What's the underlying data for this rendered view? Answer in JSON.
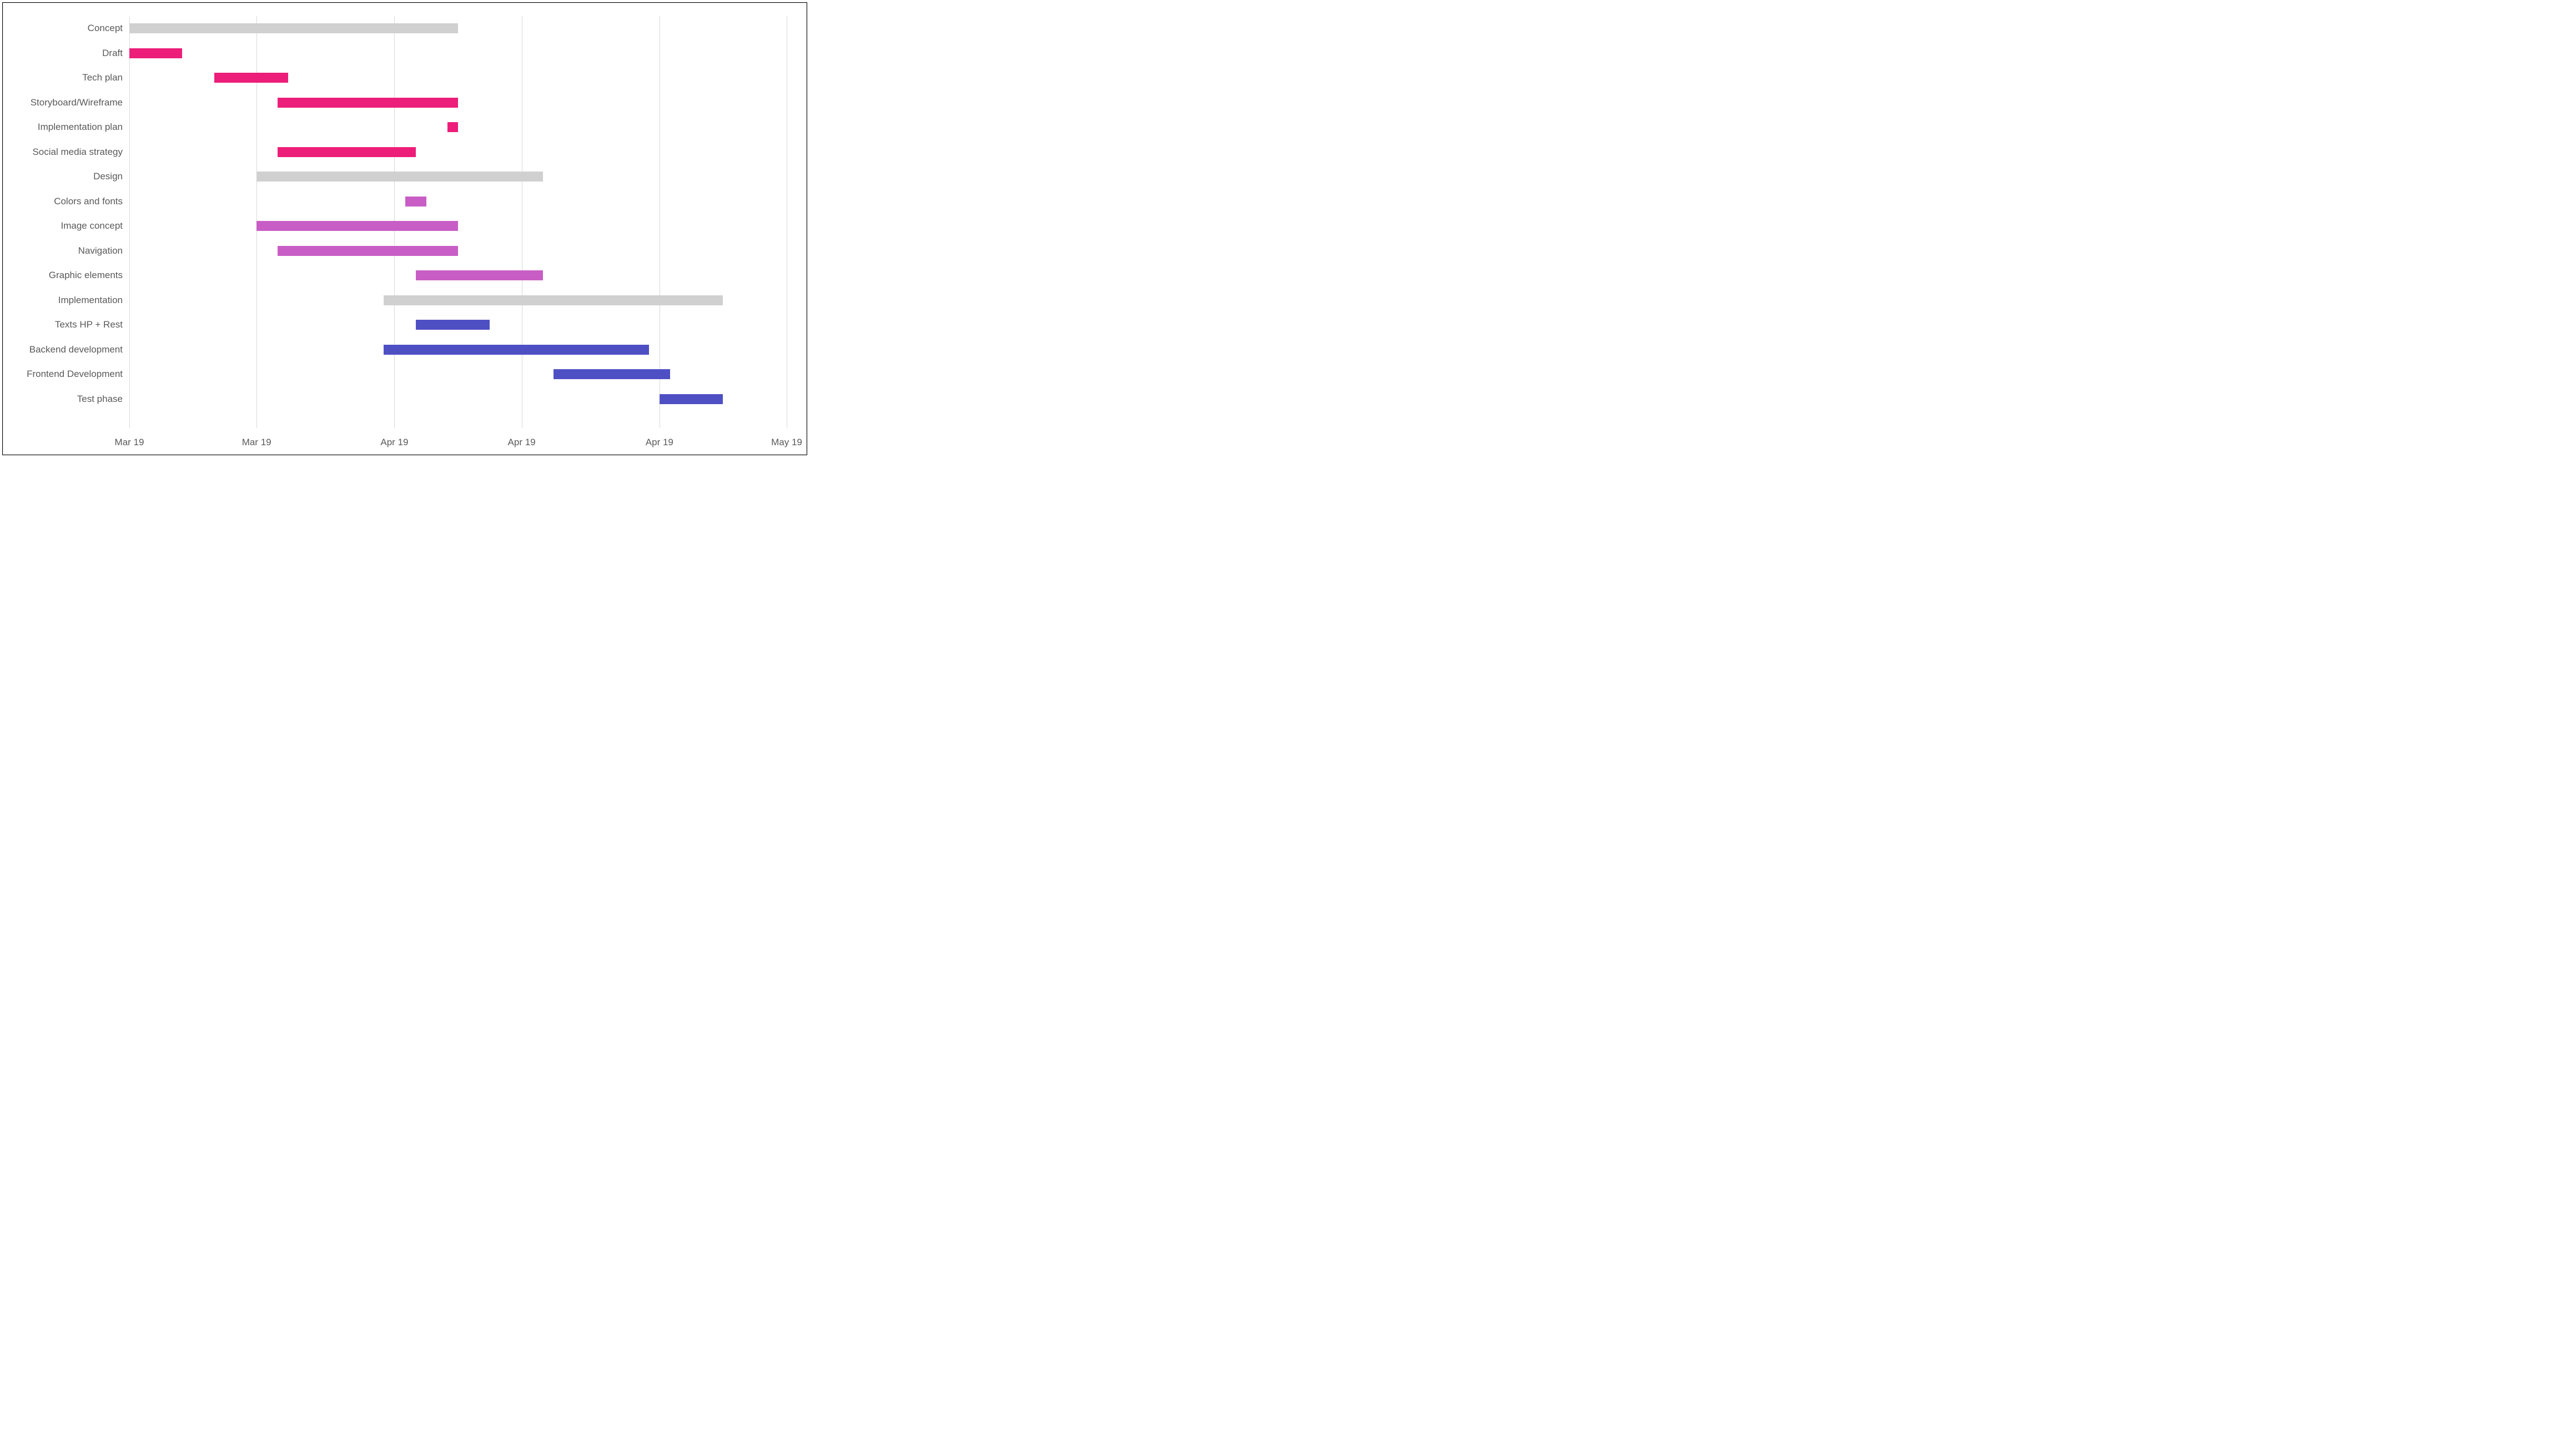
{
  "chart_data": {
    "type": "gantt",
    "title": "",
    "x_axis": {
      "min_day": 0,
      "max_day": 62,
      "ticks": [
        {
          "day": 0,
          "label": "Mar 19"
        },
        {
          "day": 12,
          "label": "Mar 19"
        },
        {
          "day": 25,
          "label": "Apr 19"
        },
        {
          "day": 37,
          "label": "Apr 19"
        },
        {
          "day": 50,
          "label": "Apr 19"
        },
        {
          "day": 62,
          "label": "May 19"
        }
      ]
    },
    "colors": {
      "summary": "#d0d0d0",
      "concept_task": "#ec1e79",
      "design_task": "#c85ec5",
      "impl_task": "#4f4fc4"
    },
    "tasks": [
      {
        "label": "Concept",
        "start": 0,
        "end": 31,
        "color_key": "summary",
        "type": "summary"
      },
      {
        "label": "Draft",
        "start": 0,
        "end": 5,
        "color_key": "concept_task",
        "type": "task"
      },
      {
        "label": "Tech plan",
        "start": 8,
        "end": 15,
        "color_key": "concept_task",
        "type": "task"
      },
      {
        "label": "Storyboard/Wireframe",
        "start": 14,
        "end": 31,
        "color_key": "concept_task",
        "type": "task"
      },
      {
        "label": "Implementation plan",
        "start": 30,
        "end": 31,
        "color_key": "concept_task",
        "type": "task"
      },
      {
        "label": "Social media strategy",
        "start": 14,
        "end": 27,
        "color_key": "concept_task",
        "type": "task"
      },
      {
        "label": "Design",
        "start": 12,
        "end": 39,
        "color_key": "summary",
        "type": "summary"
      },
      {
        "label": "Colors and fonts",
        "start": 26,
        "end": 28,
        "color_key": "design_task",
        "type": "task"
      },
      {
        "label": "Image concept",
        "start": 12,
        "end": 31,
        "color_key": "design_task",
        "type": "task"
      },
      {
        "label": "Navigation",
        "start": 14,
        "end": 31,
        "color_key": "design_task",
        "type": "task"
      },
      {
        "label": "Graphic elements",
        "start": 27,
        "end": 39,
        "color_key": "design_task",
        "type": "task"
      },
      {
        "label": "Implementation",
        "start": 24,
        "end": 56,
        "color_key": "summary",
        "type": "summary"
      },
      {
        "label": "Texts HP + Rest",
        "start": 27,
        "end": 34,
        "color_key": "impl_task",
        "type": "task"
      },
      {
        "label": "Backend development",
        "start": 24,
        "end": 49,
        "color_key": "impl_task",
        "type": "task"
      },
      {
        "label": "Frontend Development",
        "start": 40,
        "end": 51,
        "color_key": "impl_task",
        "type": "task"
      },
      {
        "label": "Test phase",
        "start": 50,
        "end": 56,
        "color_key": "impl_task",
        "type": "task"
      }
    ]
  }
}
